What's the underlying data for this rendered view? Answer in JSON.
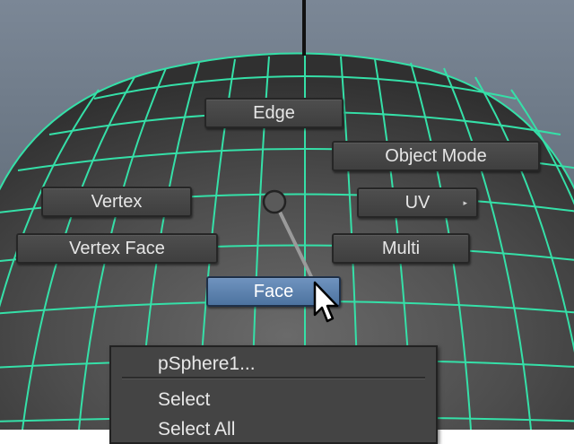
{
  "marking_menu": {
    "edge": "Edge",
    "object_mode": "Object Mode",
    "vertex": "Vertex",
    "uv": "UV",
    "vertex_face": "Vertex Face",
    "multi": "Multi",
    "face": "Face",
    "highlighted": "Face"
  },
  "context_menu": {
    "title": "pSphere1...",
    "items": [
      "Select",
      "Select All"
    ]
  },
  "colors": {
    "wireframe": "#35e0a8",
    "active_button": "#5a82b2"
  },
  "icons": [
    "cursor-arrow-icon",
    "submenu-arrow-icon"
  ]
}
